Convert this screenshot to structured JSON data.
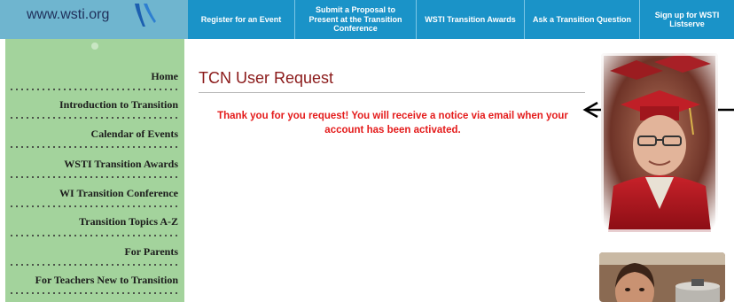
{
  "header": {
    "logo_text": "www.wsti.org",
    "nav": [
      {
        "label": "Register for an Event"
      },
      {
        "label": "Submit a Proposal to Present at the Transition Conference"
      },
      {
        "label": "WSTI Transition Awards"
      },
      {
        "label": "Ask a Transition Question"
      },
      {
        "label": "Sign up for WSTI Listserve"
      }
    ]
  },
  "sidebar": {
    "items": [
      {
        "label": "Home"
      },
      {
        "label": "Introduction to Transition"
      },
      {
        "label": "Calendar of Events"
      },
      {
        "label": "WSTI Transition Awards"
      },
      {
        "label": "WI Transition Conference"
      },
      {
        "label": "Transition Topics A-Z"
      },
      {
        "label": "For Parents"
      },
      {
        "label": "For Teachers New to Transition"
      }
    ]
  },
  "main": {
    "title": "TCN User Request",
    "message_line1": "Thank you for you request! You will receive a notice via email when your",
    "message_line2": "account has been activated."
  },
  "colors": {
    "nav_bg": "#1a93c8",
    "logo_bg": "#6fb5cf",
    "sidebar_bg": "#a3d39c",
    "title": "#8b1a1a",
    "message": "#e41b1b"
  },
  "icons": {
    "logo_mark": "swoosh-icon",
    "annotation": "arrow-left-icon"
  }
}
